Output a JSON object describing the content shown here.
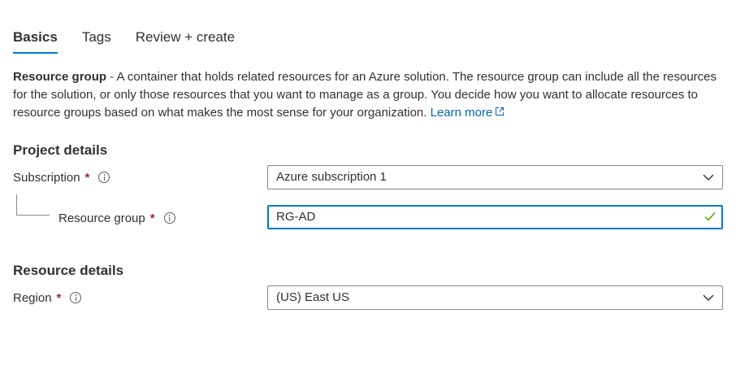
{
  "tabs": [
    {
      "label": "Basics",
      "active": true
    },
    {
      "label": "Tags",
      "active": false
    },
    {
      "label": "Review + create",
      "active": false
    }
  ],
  "description": {
    "title": "Resource group",
    "text": " - A container that holds related resources for an Azure solution. The resource group can include all the resources for the solution, or only those resources that you want to manage as a group. You decide how you want to allocate resources to resource groups based on what makes the most sense for your organization. ",
    "link_label": "Learn more"
  },
  "project_details": {
    "title": "Project details",
    "subscription": {
      "label": "Subscription",
      "required": "*",
      "value": "Azure subscription 1"
    },
    "resource_group": {
      "label": "Resource group",
      "required": "*",
      "value": "RG-AD"
    }
  },
  "resource_details": {
    "title": "Resource details",
    "region": {
      "label": "Region",
      "required": "*",
      "value": "(US) East US"
    }
  },
  "colors": {
    "accent": "#0078d4",
    "link": "#0067b8",
    "required": "#a4262c",
    "valid_check": "#57a300",
    "text": "#323130"
  },
  "icons": [
    "info-icon",
    "chevron-down-icon",
    "checkmark-icon",
    "external-link-icon"
  ]
}
